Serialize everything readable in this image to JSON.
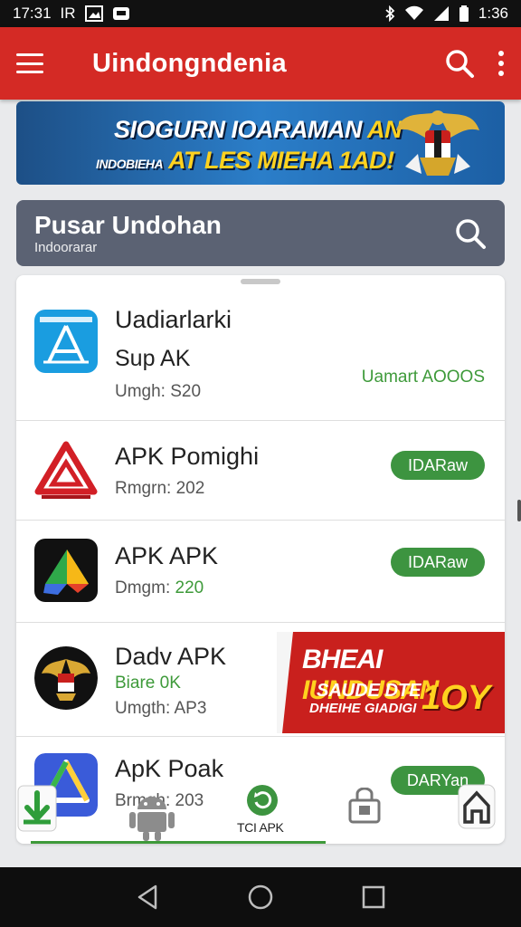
{
  "status_bar": {
    "time_left": "17:31",
    "left_label": "IR",
    "time_right": "1:36"
  },
  "app_bar": {
    "title": "Uindongndenia"
  },
  "banner": {
    "line1_a": "SIOGURN IOARAMAN",
    "line1_b": "AN",
    "line2_a": "INDOBIEHA",
    "line2_b": "AT LES MIEHA 1AD!"
  },
  "search_card": {
    "title": "Pusar Undohan",
    "subtitle": "Indoorarar"
  },
  "apps": [
    {
      "name": "Uadiarlarki",
      "name2": "Sup AK",
      "meta": "Umgh: S20",
      "status": "Uamart AOOOS"
    },
    {
      "name": "APK Pomighi",
      "meta": "Rmgrn: 202",
      "action": "IDARaw"
    },
    {
      "name": "APK APK",
      "meta_a": "Dmgm:",
      "meta_b": "220",
      "action": "IDARaw"
    },
    {
      "name": "Dadv APK",
      "meta_green": "Biare 0K",
      "meta": "Umgth: AP3"
    },
    {
      "name": "ApK Poak",
      "meta": "Brmgh: 203",
      "action": "DARYan"
    }
  ],
  "promo": {
    "line1_a": "BHEAI",
    "line1_b": "IUNDUSAN",
    "line2": "SAUDE DTE",
    "line3": "DHEIHE GIADIGI",
    "big": "1OY"
  },
  "bottom_tab": {
    "label": "TCI APK"
  },
  "colors": {
    "app_bar": "#d42a25",
    "accent_green": "#3d9440",
    "search_card": "#5b6273"
  }
}
